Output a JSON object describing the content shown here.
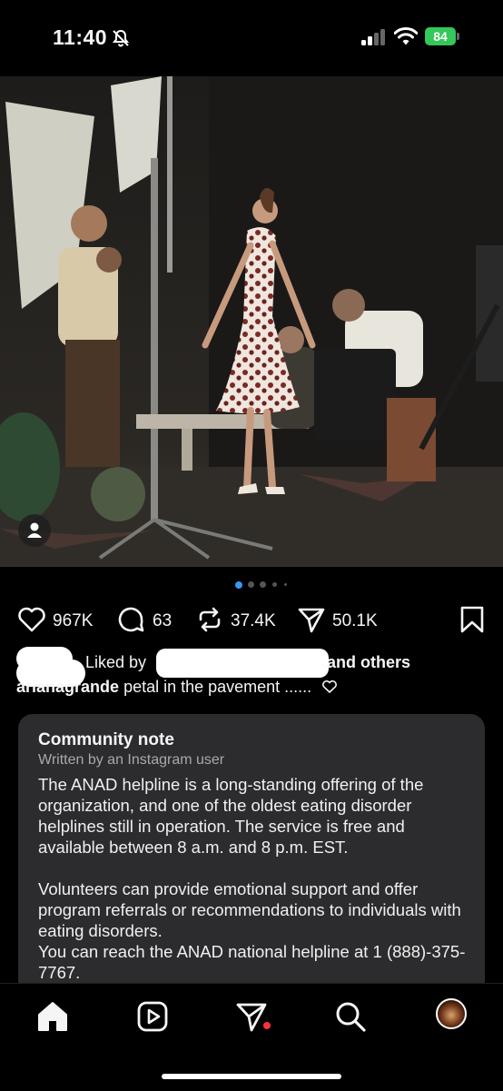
{
  "status_bar": {
    "time": "11:40",
    "battery": "84",
    "icons": [
      "bell-slash-icon",
      "cellular-signal-icon",
      "wifi-icon",
      "battery-icon"
    ]
  },
  "post": {
    "image_description_icon": "photo",
    "carousel": {
      "total_dots": 5,
      "active_index": 0
    },
    "actions": {
      "likes": "967K",
      "comments": "63",
      "reposts": "37.4K",
      "shares": "50.1K"
    },
    "liked_by": {
      "prefix": "Liked by",
      "suffix": "and others"
    },
    "caption": {
      "username": "arianagrande",
      "text": "petal in the pavement ......"
    }
  },
  "community_note": {
    "title": "Community note",
    "subtitle": "Written by an Instagram user",
    "paragraphs": [
      "The ANAD helpline is a long-standing offering of the organization, and one of the oldest eating disorder helplines still in operation. The service is free and available between 8 a.m. and 8 p.m. EST.",
      "Volunteers can provide emotional support and offer program referrals or recommendations to individuals with eating disorders.\nYou can reach the ANAD national helpline at 1 (888)-375-7767."
    ]
  },
  "bottom_nav": {
    "items": [
      "home-icon",
      "reels-icon",
      "direct-messages-icon",
      "search-icon",
      "profile-avatar"
    ],
    "accent": "#ff3040"
  },
  "colors": {
    "background": "#000000",
    "card": "#2c2c2e",
    "battery": "#34c759",
    "active_dot": "#3897f0"
  }
}
